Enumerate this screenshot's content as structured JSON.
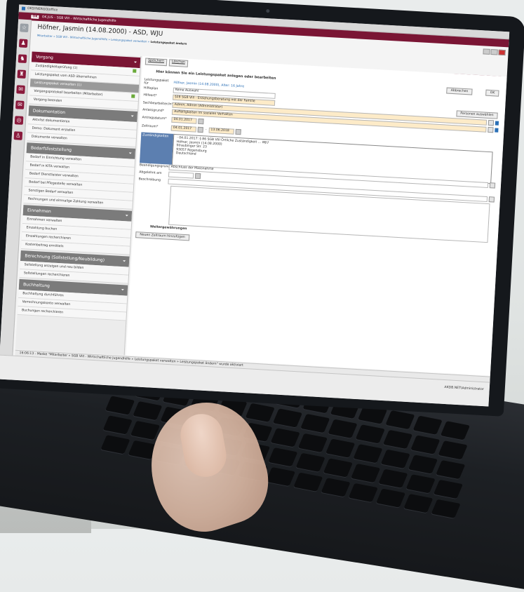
{
  "os_title": "OKSYNERGO|office",
  "app_bar": {
    "brand": "OK",
    "title": "OK.JUS – SGB VIII – Wirtschaftliche Jugendhilfe"
  },
  "header": {
    "person": "Höfner, Jasmin (14.08.2000) - ASD, WJU",
    "crumb_path": "Mitarbeiter » SGB VIII - Wirtschaftliche Jugendhilfe » Leistungspaket verwalten »",
    "crumb_current": " Leistungspaket ändern"
  },
  "top_tabs": [
    "Objekt",
    "Info",
    "Tools"
  ],
  "sidebar": {
    "sections": [
      {
        "title": "Vorgang",
        "active": true,
        "items": [
          {
            "label": "Zuständigkeitsprüfung (1)",
            "check": true
          },
          {
            "label": "Leistungspaket vom ASD übernehmen",
            "check": false
          },
          {
            "label": "Leistungspaket verwalten (1)",
            "check": false,
            "hl": true
          },
          {
            "label": "Vorgangsprotokoll bearbeiten (Mitarbeiter)",
            "check": true
          },
          {
            "label": "Vorgang beenden",
            "check": false
          }
        ]
      },
      {
        "title": "Dokumentation",
        "items": [
          {
            "label": "Aktvlist dokumentieren"
          },
          {
            "label": "Demo: Dokument erstellen"
          },
          {
            "label": "Dokumente verwalten"
          }
        ]
      },
      {
        "title": "Bedarfsfeststellung",
        "items": [
          {
            "label": "Bedarf in Einrichtung verwalten"
          },
          {
            "label": "Bedarf in KITA verwalten"
          },
          {
            "label": "Bedarf Dienstleister verwalten"
          },
          {
            "label": "Bedarf bei Pflegestelle verwalten"
          },
          {
            "label": "Sonstigen Bedarf verwalten"
          },
          {
            "label": "Rechnungen und einmalige Zahlung verwalten"
          }
        ]
      },
      {
        "title": "Einnahmen",
        "items": [
          {
            "label": "Einnahmen verwalten"
          },
          {
            "label": "Einzahlung buchen"
          },
          {
            "label": "Einzahlungen recherchieren"
          },
          {
            "label": "Kostenbeitrag ermitteln"
          }
        ]
      },
      {
        "title": "Berechnung (Sollstellung/Neubildung)",
        "items": [
          {
            "label": "Sollstellung anzeigen und neu bilden"
          },
          {
            "label": "Sollstellungen recherchieren"
          }
        ]
      },
      {
        "title": "Buchhaltung",
        "items": [
          {
            "label": "Buchhaltung durchführen"
          },
          {
            "label": "Verrechnungskonto verwalten"
          },
          {
            "label": "Buchungen recherchieren"
          }
        ]
      }
    ]
  },
  "toolbar": {
    "save": "Speichern",
    "delete": "Löschen"
  },
  "panel": {
    "title": "Hier können Sie ein Leistungspaket anlegen oder bearbeiten",
    "cancel": "Abbrechen",
    "ok": "OK",
    "person_select": "Personen auswählen",
    "fields": {
      "leistungspaket_label": "Leistungspaket für",
      "leistungspaket_value": "Höfner, Jasmin (14.08.2000), Alter: 16 Jahre",
      "hilfeplan_label": "Hilfeplan",
      "hilfeplan_value": "Keine Auswahl",
      "hilfeart_label": "Hilfeart*",
      "hilfeart_value": "§28 SGB VIII - Erziehungsberatung mit der Familie",
      "sachbearbeiter_label": "Sachbearbeiter/in*",
      "sachbearbeiter_value": "Admin, Admin (Administrator)",
      "anlassgrund_label": "Anlassgrund*",
      "anlassgrund_value": "Auffälligkeiten im sozialen Verhalten",
      "antragsdatum_label": "Antragsdatum*",
      "antragsdatum_value": "04.01.2017",
      "zeitraum_label": "Zeitraum*",
      "zeitraum_from": "04.01.2017",
      "zeitraum_to": "13.06.2018",
      "zust_label": "Zuständigkeiten",
      "address": [
        "- 04.01.2017: § 86 SGB VIII Örtliche Zuständigkeit ... WJU",
        "Höfner, Jasmin (14.08.2000)",
        "Straubinger Str. 23",
        "93057 Regensburg",
        "Deutschland"
      ],
      "beendigung_label": "Beendigungsgrund",
      "beendigung_value": "Abschluss der Massnahme",
      "abgelehnt_label": "Abgelehnt am",
      "beschreibung_label": "Beschreibung",
      "weiter_title": "Weitergewährungen",
      "neuer_zeitraum": "Neuen Zeitraum hinzufügen"
    }
  },
  "status_bar": "16:06:13 - Maske \"Mitarbeiter » SGB VIII - Wirtschaftliche Jugendhilfe » Leistungspaket verwalten » Leistungspaket ändern\" wurde aktiviert",
  "footer_user": "AKDB.NET\\Administrator"
}
